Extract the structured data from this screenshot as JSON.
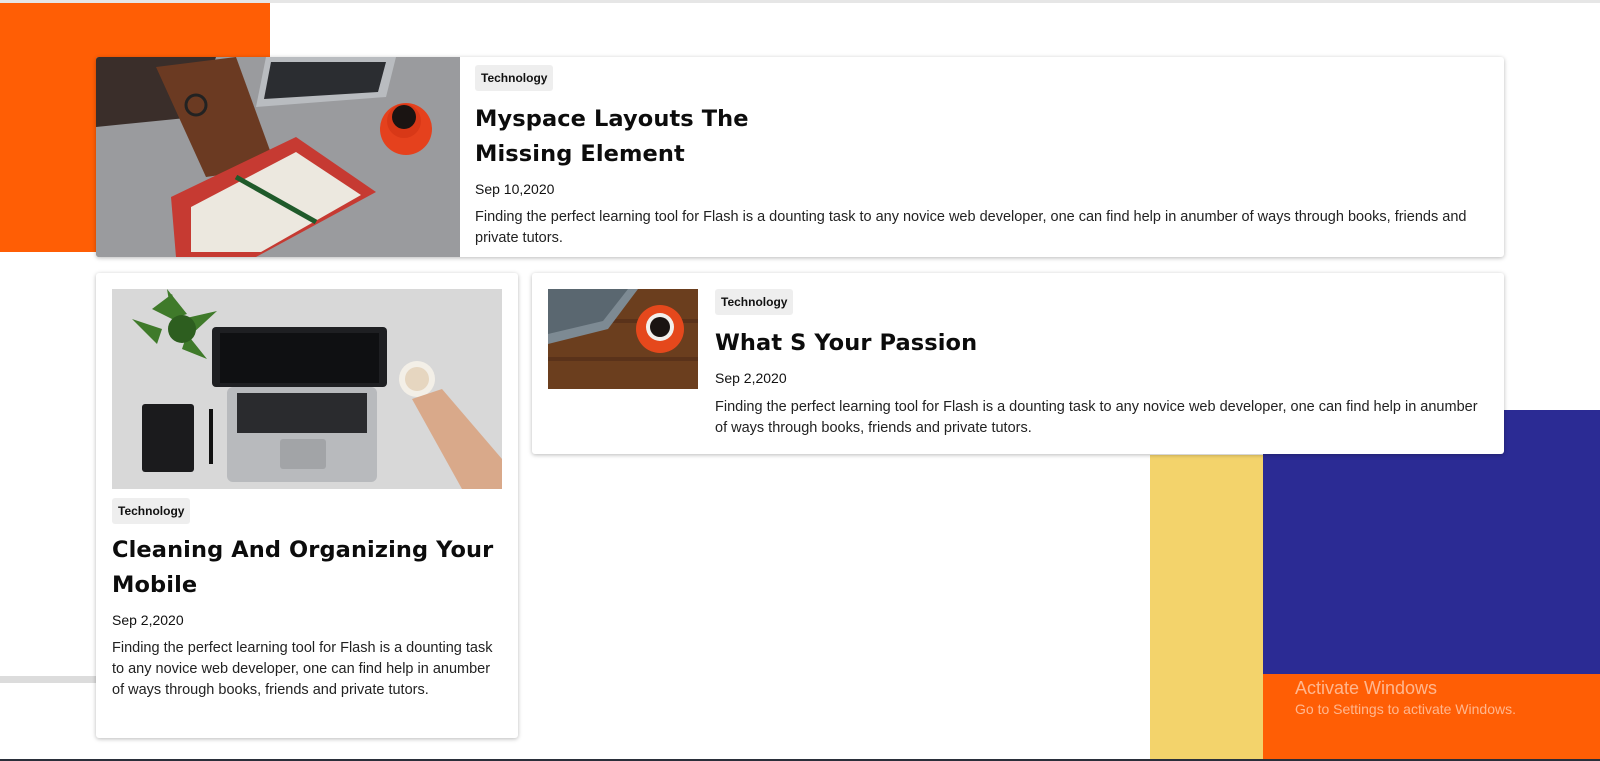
{
  "colors": {
    "orange": "#ff5e05",
    "blue": "#2b2b94",
    "yellow": "#f3d36b",
    "tag_bg": "#eeeeee"
  },
  "posts": [
    {
      "category": "Technology",
      "title": "Myspace Layouts The Missing Element",
      "date": "Sep 10,2020",
      "excerpt": "Finding the perfect learning tool for Flash is a dounting task to any novice web developer, one can find help in anumber of ways through books, friends and private tutors.",
      "image": "desk-notebook-coffee-photo"
    },
    {
      "category": "Technology",
      "title": "Cleaning And Organizing Your Mobile",
      "date": "Sep 2,2020",
      "excerpt": "Finding the perfect learning tool for Flash is a dounting task to any novice web developer, one can find help in anumber of ways through books, friends and private tutors.",
      "image": "laptop-plant-coffee-photo"
    },
    {
      "category": "Technology",
      "title": "What S Your Passion",
      "date": "Sep 2,2020",
      "excerpt": "Finding the perfect learning tool for Flash is a dounting task to any novice web developer, one can find help in anumber of ways through books, friends and private tutors.",
      "image": "laptop-coffee-wood-photo"
    }
  ],
  "watermark": {
    "line1": "Activate Windows",
    "line2": "Go to Settings to activate Windows."
  }
}
